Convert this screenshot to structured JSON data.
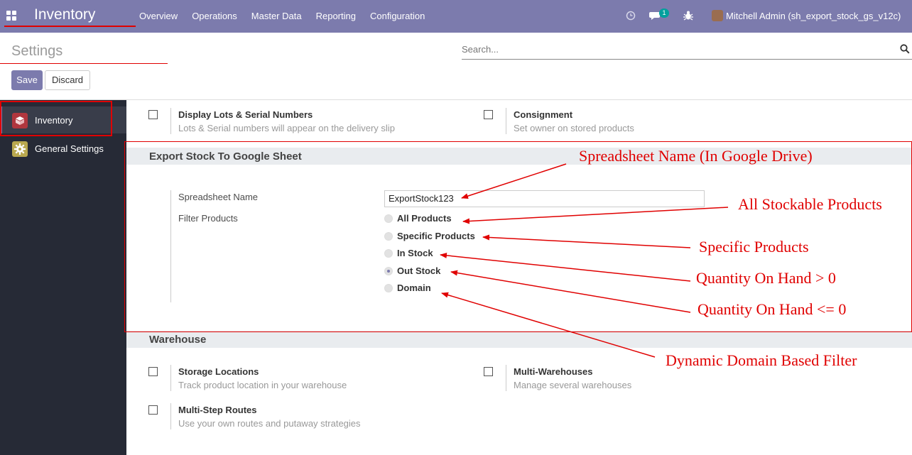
{
  "navbar": {
    "app_name": "Inventory",
    "menu": [
      "Overview",
      "Operations",
      "Master Data",
      "Reporting",
      "Configuration"
    ],
    "chat_badge": "1",
    "user": "Mitchell Admin (sh_export_stock_gs_v12c)"
  },
  "control_panel": {
    "title": "Settings",
    "search_placeholder": "Search...",
    "save_label": "Save",
    "discard_label": "Discard"
  },
  "sidebar": {
    "items": [
      {
        "label": "Inventory",
        "icon": "inventory-icon"
      },
      {
        "label": "General Settings",
        "icon": "gear-icon"
      }
    ]
  },
  "top_settings": [
    {
      "title": "Display Lots & Serial Numbers",
      "desc": "Lots & Serial numbers will appear on the delivery slip"
    },
    {
      "title": "Consignment",
      "desc": "Set owner on stored products"
    }
  ],
  "export": {
    "header": "Export Stock To Google Sheet",
    "spreadsheet_label": "Spreadsheet Name",
    "spreadsheet_value": "ExportStock123",
    "filter_label": "Filter Products",
    "options": [
      "All Products",
      "Specific Products",
      "In Stock",
      "Out Stock",
      "Domain"
    ],
    "selected": "Out Stock"
  },
  "warehouse": {
    "header": "Warehouse",
    "settings": [
      {
        "title": "Storage Locations",
        "desc": "Track product location in your warehouse"
      },
      {
        "title": "Multi-Warehouses",
        "desc": "Manage several warehouses"
      },
      {
        "title": "Multi-Step Routes",
        "desc": "Use your own routes and putaway strategies"
      }
    ]
  },
  "annotations": [
    "Spreadsheet Name (In Google Drive)",
    "All Stockable Products",
    "Specific Products",
    "Quantity On Hand > 0",
    "Quantity On Hand <= 0",
    "Dynamic Domain Based Filter"
  ],
  "colors": {
    "brand": "#7c7bad",
    "annotation": "#e00000",
    "sidebar": "#262a36"
  }
}
